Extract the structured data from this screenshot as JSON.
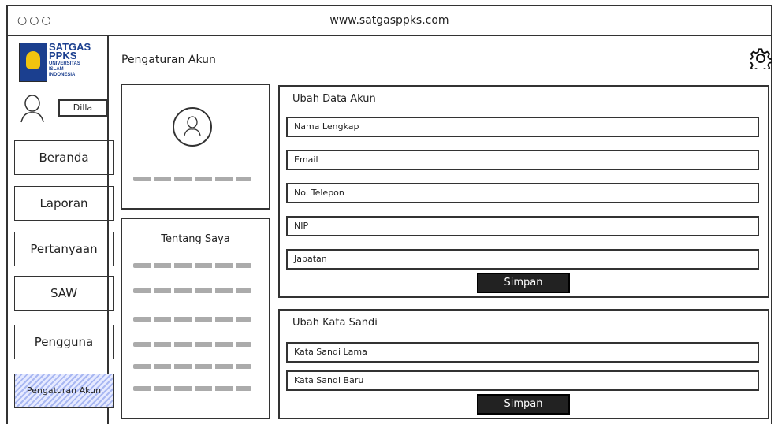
{
  "browser": {
    "url": "www.satgasppks.com",
    "dots": "○○○"
  },
  "logo": {
    "title_line1": "SATGAS",
    "title_line2": "PPKS",
    "sub_line1": "UNIVERSITAS",
    "sub_line2": "ISLAM",
    "sub_line3": "INDONESIA"
  },
  "user": {
    "name": "Dilla"
  },
  "sidebar": {
    "items": [
      {
        "label": "Beranda"
      },
      {
        "label": "Laporan"
      },
      {
        "label": "Pertanyaan"
      },
      {
        "label": "SAW"
      },
      {
        "label": "Pengguna"
      },
      {
        "label": "Pengaturan Akun",
        "active": true
      }
    ]
  },
  "page": {
    "title": "Pengaturan Akun"
  },
  "about": {
    "title": "Tentang Saya"
  },
  "account_form": {
    "title": "Ubah Data Akun",
    "fields": [
      "Nama Lengkap",
      "Email",
      "No. Telepon",
      "NIP",
      "Jabatan"
    ],
    "save_label": "Simpan"
  },
  "password_form": {
    "title": "Ubah Kata Sandi",
    "fields": [
      "Kata Sandi Lama",
      "Kata Sandi Baru"
    ],
    "save_label": "Simpan"
  },
  "icons": {
    "settings": "gear-icon",
    "user": "user-icon"
  }
}
